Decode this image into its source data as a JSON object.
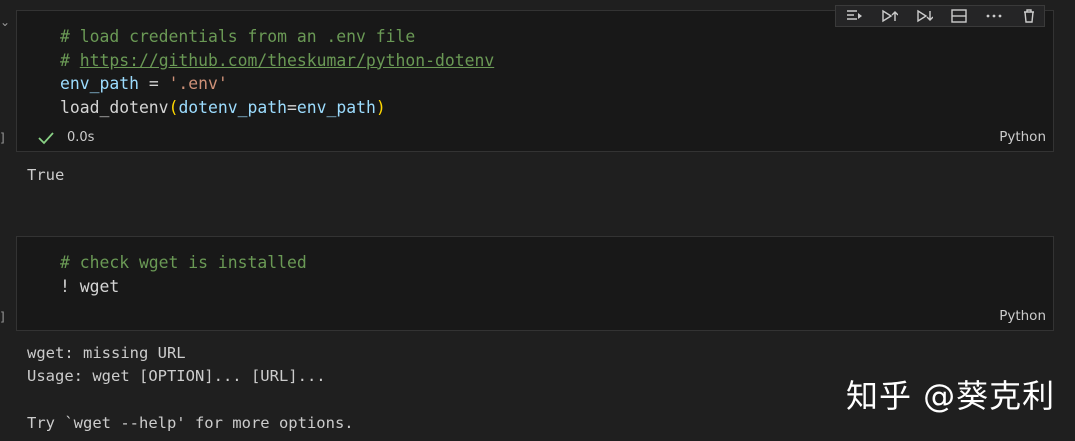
{
  "cells": [
    {
      "code_lines": [
        [
          {
            "type": "comment",
            "text": "# load credentials from an .env file"
          }
        ],
        [
          {
            "type": "comment",
            "text": "# "
          },
          {
            "type": "link",
            "text": "https://github.com/theskumar/python-dotenv"
          }
        ],
        [
          {
            "type": "var",
            "text": "env_path"
          },
          {
            "type": "plain",
            "text": " = "
          },
          {
            "type": "string",
            "text": "'.env'"
          }
        ],
        [
          {
            "type": "plain",
            "text": "load_dotenv"
          },
          {
            "type": "paren",
            "text": "("
          },
          {
            "type": "var",
            "text": "dotenv_path"
          },
          {
            "type": "plain",
            "text": "="
          },
          {
            "type": "var",
            "text": "env_path"
          },
          {
            "type": "paren",
            "text": ")"
          }
        ]
      ],
      "status_icon": "check-icon",
      "status_color": "#89d185",
      "duration": "0.0s",
      "language": "Python",
      "output": "True"
    },
    {
      "code_lines": [
        [
          {
            "type": "comment",
            "text": "# check wget is installed"
          }
        ],
        [
          {
            "type": "plain",
            "text": "! wget"
          }
        ]
      ],
      "language": "Python",
      "output": "wget: missing URL\nUsage: wget [OPTION]... [URL]...\n\nTry `wget --help' for more options."
    }
  ],
  "toolbar_icons": [
    "run-by-line-icon",
    "execute-above-icon",
    "execute-below-icon",
    "split-cell-icon",
    "more-actions-icon",
    "delete-icon"
  ],
  "watermark": "知乎 @葵克利"
}
